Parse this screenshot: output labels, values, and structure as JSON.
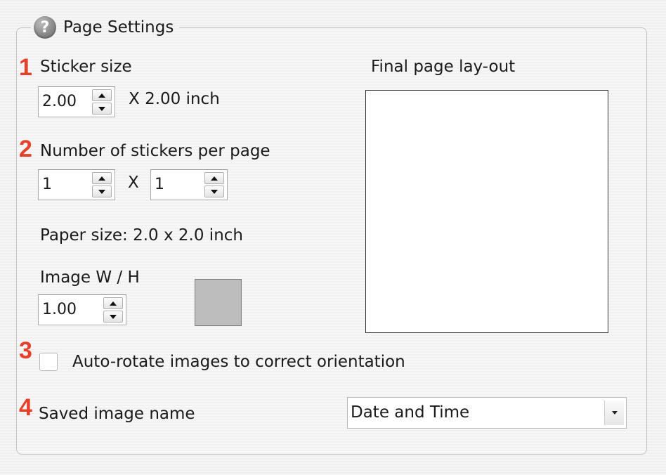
{
  "group": {
    "title": "Page Settings",
    "help_icon": "question-mark-icon"
  },
  "steps": [
    "1",
    "2",
    "3",
    "4"
  ],
  "sticker_size": {
    "label": "Sticker size",
    "width_value": "2.00",
    "suffix": "X 2.00 inch"
  },
  "stickers_per_page": {
    "label": "Number of stickers per page",
    "cols_value": "1",
    "separator": "X",
    "rows_value": "1"
  },
  "paper_size": "Paper size: 2.0 x 2.0 inch",
  "image_wh": {
    "label": "Image W / H",
    "value": "1.00",
    "swatch_color": "#bdbdbd"
  },
  "layout_preview": {
    "label": "Final page lay-out"
  },
  "auto_rotate": {
    "label": "Auto-rotate images to correct orientation",
    "checked": false
  },
  "saved_name": {
    "label": "Saved image name",
    "selected": "Date and Time"
  },
  "colors": {
    "step_number": "#e4402a"
  }
}
